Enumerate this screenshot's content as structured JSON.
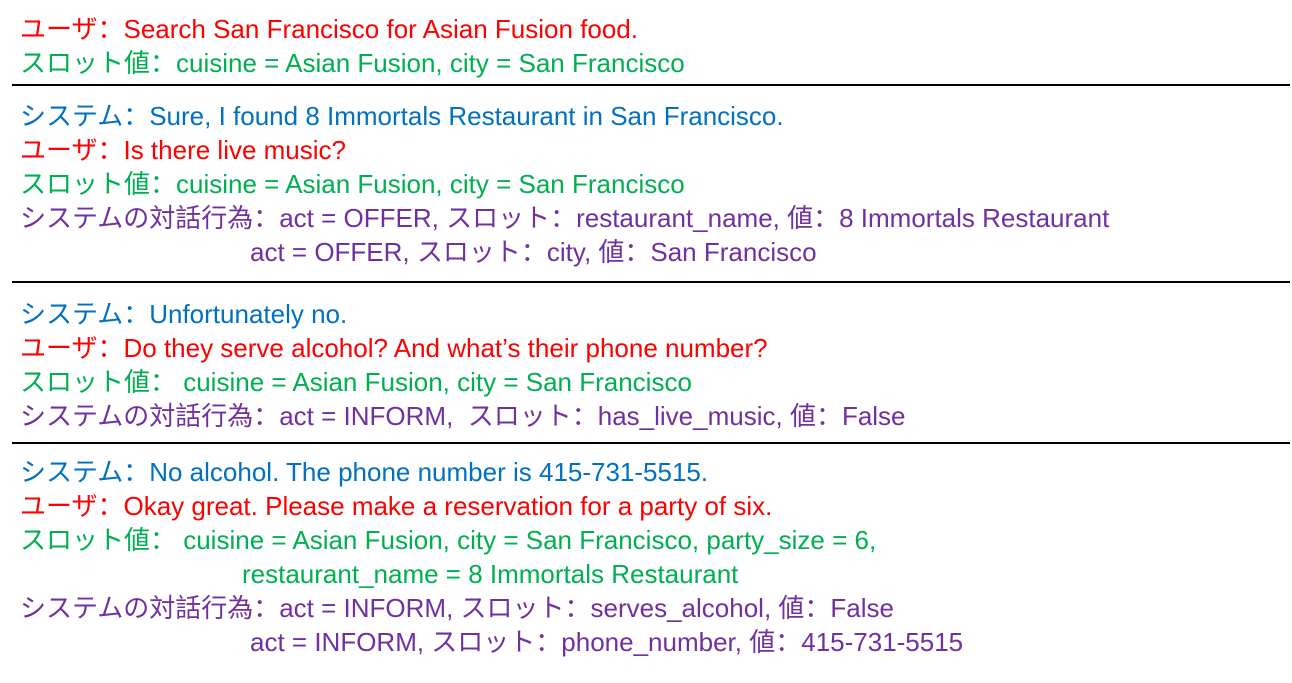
{
  "colors": {
    "user": "#ff0000",
    "slot": "#00b050",
    "system": "#0070c0",
    "act": "#7030a0",
    "separator": "#000000"
  },
  "turns": [
    {
      "lines": [
        "ユーザ：Search San Francisco for Asian Fusion food.",
        "スロット値：cuisine = Asian Fusion, city = San Francisco"
      ]
    },
    {
      "lines": [
        "システム：Sure, I found 8 Immortals Restaurant in San Francisco.",
        "ユーザ：Is there live music?",
        "スロット値：cuisine = Asian Fusion, city = San Francisco",
        "システムの対話行為：act = OFFER, スロット：restaurant_name, 値：8 Immortals Restaurant",
        "act = OFFER, スロット：city, 値：San Francisco"
      ]
    },
    {
      "lines": [
        "システム：Unfortunately no.",
        "ユーザ：Do they serve alcohol? And what’s their phone number?",
        "スロット値： cuisine = Asian Fusion, city = San Francisco",
        "システムの対話行為：act = INFORM,  スロット：has_live_music, 値：False"
      ]
    },
    {
      "lines": [
        "システム：No alcohol. The phone number is 415-731-5515.",
        "ユーザ：Okay great. Please make a reservation for a party of six.",
        "スロット値： cuisine = Asian Fusion, city = San Francisco, party_size = 6,",
        "restaurant_name = 8 Immortals Restaurant",
        "システムの対話行為：act = INFORM, スロット：serves_alcohol, 値：False",
        "act = INFORM, スロット：phone_number, 値：415-731-5515"
      ]
    }
  ]
}
